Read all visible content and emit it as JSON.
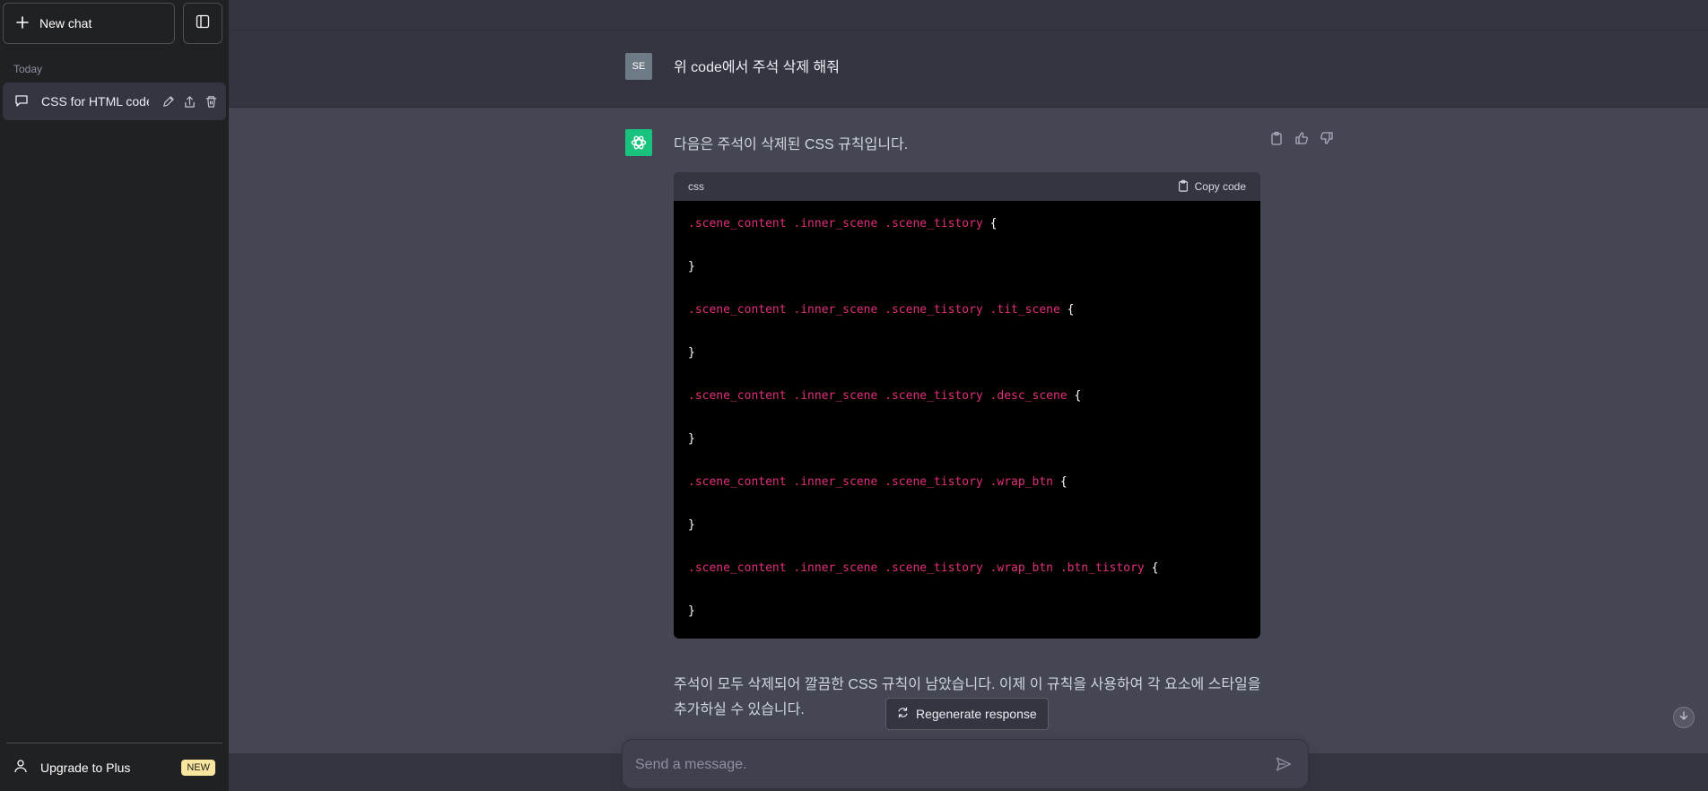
{
  "sidebar": {
    "new_chat_label": "New chat",
    "section_today": "Today",
    "chat_items": [
      {
        "title": "CSS for HTML code"
      }
    ],
    "upgrade_label": "Upgrade to Plus",
    "upgrade_badge": "NEW"
  },
  "conversation": {
    "user_avatar_initials": "SE",
    "user_message": "위 code에서 주석 삭제 해줘",
    "assistant_intro": "다음은 주석이 삭제된 CSS 규칙입니다.",
    "code_language": "css",
    "copy_code_label": "Copy code",
    "code_lines": [
      {
        "selector": ".scene_content .inner_scene .scene_tistory",
        "open": "{",
        "close": "}"
      },
      {
        "selector": ".scene_content .inner_scene .scene_tistory .tit_scene",
        "open": "{",
        "close": "}"
      },
      {
        "selector": ".scene_content .inner_scene .scene_tistory .desc_scene",
        "open": "{",
        "close": "}"
      },
      {
        "selector": ".scene_content .inner_scene .scene_tistory .wrap_btn",
        "open": "{",
        "close": "}"
      },
      {
        "selector": ".scene_content .inner_scene .scene_tistory .wrap_btn .btn_tistory",
        "open": "{",
        "close": "}"
      }
    ],
    "assistant_outro": "주석이 모두 삭제되어 깔끔한 CSS 규칙이 남았습니다. 이제 이 규칙을 사용하여 각 요소에 스타일을 추가하실 수 있습니다."
  },
  "regenerate_label": "Regenerate response",
  "composer": {
    "placeholder": "Send a message.",
    "value": ""
  },
  "colors": {
    "sidebar_bg": "#202123",
    "main_bg": "#343541",
    "assistant_bg": "#444654",
    "code_selector": "#df3079",
    "bot_avatar": "#19c37d",
    "badge_bg": "#fae69e"
  }
}
